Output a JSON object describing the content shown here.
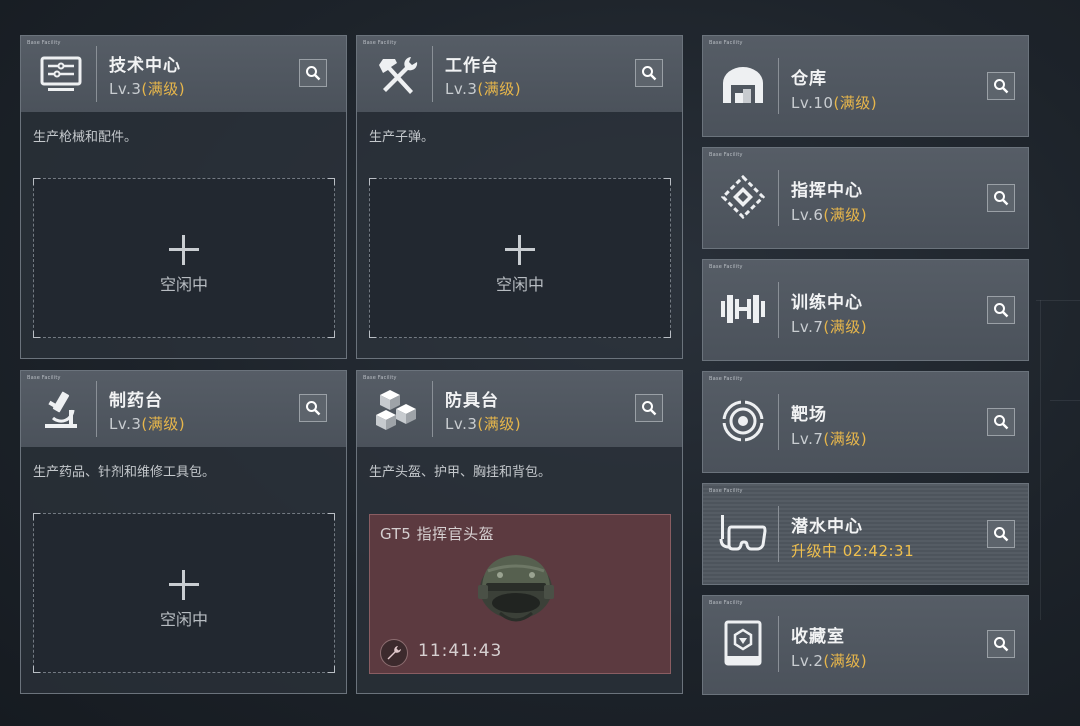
{
  "panels": {
    "tech": {
      "tag": "Base Facility",
      "title": "技术中心",
      "level": "Lv.3",
      "level_full": "(满级)",
      "desc": "生产枪械和配件。",
      "idle": "空闲中",
      "icon": "monitor-icon"
    },
    "workbench": {
      "tag": "Base Facility",
      "title": "工作台",
      "level": "Lv.3",
      "level_full": "(满级)",
      "desc": "生产子弹。",
      "idle": "空闲中",
      "icon": "hammer-wrench-icon"
    },
    "pharmacy": {
      "tag": "Base Facility",
      "title": "制药台",
      "level": "Lv.3",
      "level_full": "(满级)",
      "desc": "生产药品、针剂和维修工具包。",
      "idle": "空闲中",
      "icon": "microscope-icon"
    },
    "armor": {
      "tag": "Base Facility",
      "title": "防具台",
      "level": "Lv.3",
      "level_full": "(满级)",
      "desc": "生产头盔、护甲、胸挂和背包。",
      "craft_item": "GT5 指挥官头盔",
      "craft_timer": "11:41:43",
      "icon": "boxes-icon"
    }
  },
  "facilities": [
    {
      "tag": "Base Facility",
      "title": "仓库",
      "level": "Lv.10",
      "level_full": "(满级)",
      "icon": "warehouse-icon"
    },
    {
      "tag": "Base Facility",
      "title": "指挥中心",
      "level": "Lv.6",
      "level_full": "(满级)",
      "icon": "command-emblem-icon"
    },
    {
      "tag": "Base Facility",
      "title": "训练中心",
      "level": "Lv.7",
      "level_full": "(满级)",
      "icon": "dumbbell-icon"
    },
    {
      "tag": "Base Facility",
      "title": "靶场",
      "level": "Lv.7",
      "level_full": "(满级)",
      "icon": "target-icon"
    },
    {
      "tag": "Base Facility",
      "title": "潜水中心",
      "status": "升级中 02:42:31",
      "icon": "diving-mask-icon"
    },
    {
      "tag": "Base Facility",
      "title": "收藏室",
      "level": "Lv.2",
      "level_full": "(满级)",
      "icon": "display-case-icon"
    }
  ],
  "colors": {
    "accent": "#e7b64b",
    "craft_bg": "#5c3a40",
    "panel_head": "#525962"
  }
}
